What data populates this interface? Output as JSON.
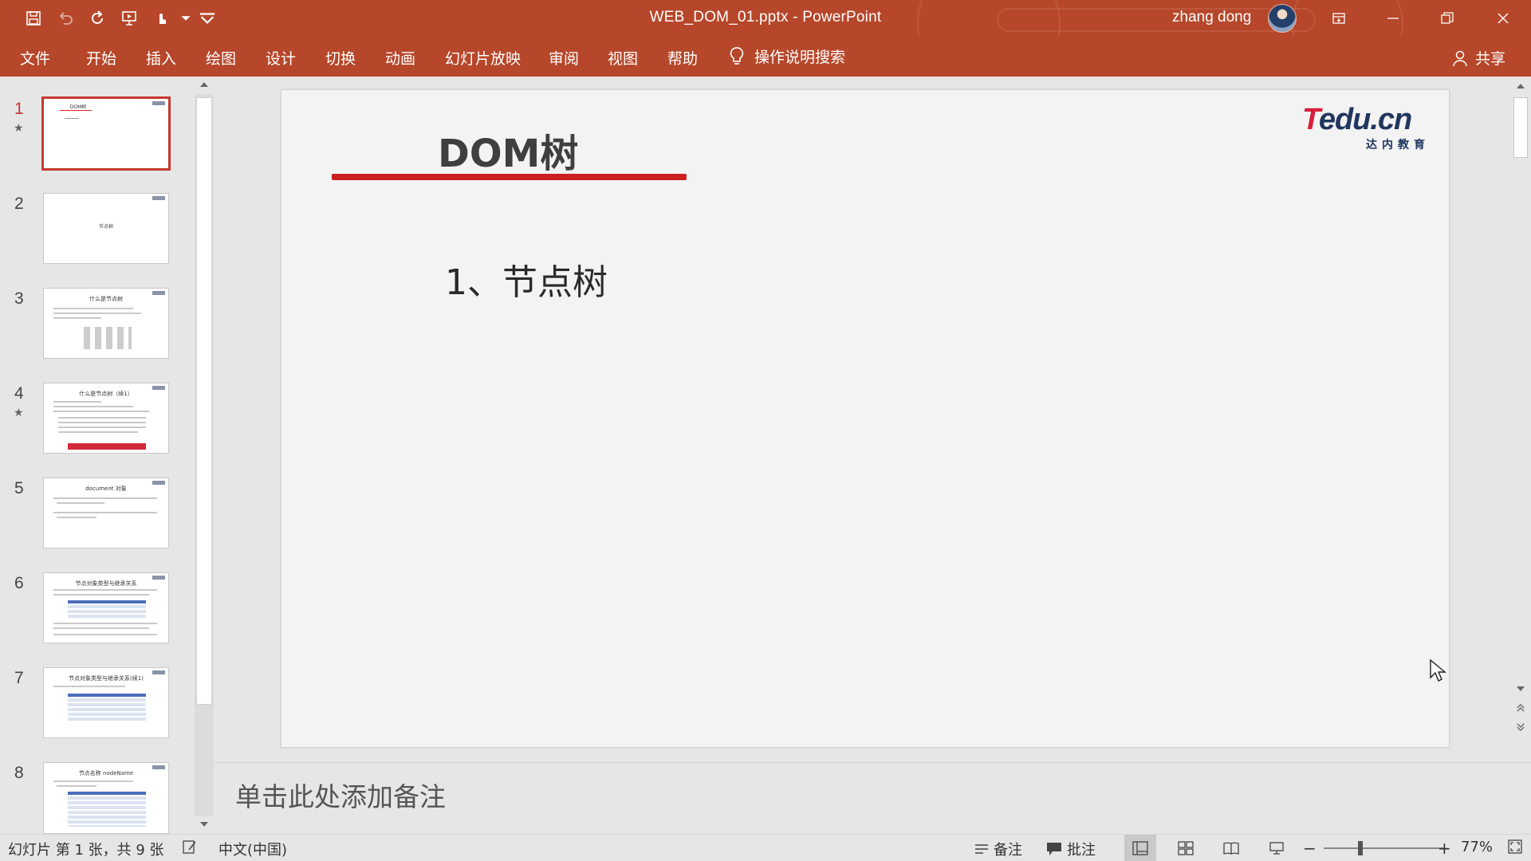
{
  "window": {
    "title": "WEB_DOM_01.pptx  -  PowerPoint",
    "user": "zhang dong"
  },
  "ribbon": {
    "tabs": [
      "文件",
      "开始",
      "插入",
      "绘图",
      "设计",
      "切换",
      "动画",
      "幻灯片放映",
      "审阅",
      "视图",
      "帮助"
    ],
    "tell_me": "操作说明搜索",
    "share": "共享"
  },
  "thumbnails": [
    {
      "num": "1",
      "title": "DOM树",
      "has_animation": true,
      "selected": true
    },
    {
      "num": "2",
      "title": "节点树",
      "has_animation": false
    },
    {
      "num": "3",
      "title": "什么是节点树",
      "has_animation": false
    },
    {
      "num": "4",
      "title": "什么是节点树（续1）",
      "has_animation": true
    },
    {
      "num": "5",
      "title": "document 对象",
      "has_animation": false
    },
    {
      "num": "6",
      "title": "节点对象类型与继承关系",
      "has_animation": false
    },
    {
      "num": "7",
      "title": "节点对象类型与继承关系(续1)",
      "has_animation": false
    },
    {
      "num": "8",
      "title": "节点名称 nodeName",
      "has_animation": false
    }
  ],
  "slide": {
    "title": "DOM树",
    "body": "1、节点树",
    "logo": {
      "main_t": "T",
      "main_rest": "edu.cn",
      "sub": "达内教育"
    }
  },
  "notes": {
    "placeholder": "单击此处添加备注"
  },
  "status": {
    "slide_info": "幻灯片 第 1 张，共 9 张",
    "language": "中文(中国)",
    "notes_label": "备注",
    "comments_label": "批注",
    "zoom_minus": "−",
    "zoom_plus": "+",
    "zoom": "77%"
  },
  "colors": {
    "accent": "#b7472a",
    "selection": "#c4392c",
    "underline": "#cc1f1f"
  }
}
